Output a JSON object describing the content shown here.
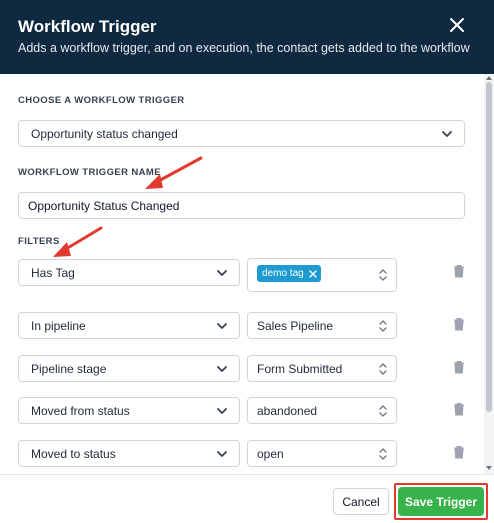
{
  "header": {
    "title": "Workflow Trigger",
    "subtitle": "Adds a workflow trigger, and on execution, the contact gets added to the workflow"
  },
  "trigger": {
    "section_label": "CHOOSE A WORKFLOW TRIGGER",
    "selected": "Opportunity status changed"
  },
  "trigger_name": {
    "section_label": "WORKFLOW TRIGGER NAME",
    "value": "Opportunity Status Changed"
  },
  "filters": {
    "section_label": "FILTERS",
    "rows": [
      {
        "field": "Has Tag",
        "tag": "demo tag"
      },
      {
        "field": "In pipeline",
        "value": "Sales Pipeline"
      },
      {
        "field": "Pipeline stage",
        "value": "Form Submitted"
      },
      {
        "field": "Moved from status",
        "value": "abandoned"
      },
      {
        "field": "Moved to status",
        "value": "open"
      }
    ]
  },
  "footer": {
    "cancel_label": "Cancel",
    "save_label": "Save Trigger"
  },
  "colors": {
    "header_bg": "#0f2940",
    "tag_bg": "#1d9bd1",
    "save_bg": "#38b24a",
    "annotation_red": "#e23a2f"
  }
}
